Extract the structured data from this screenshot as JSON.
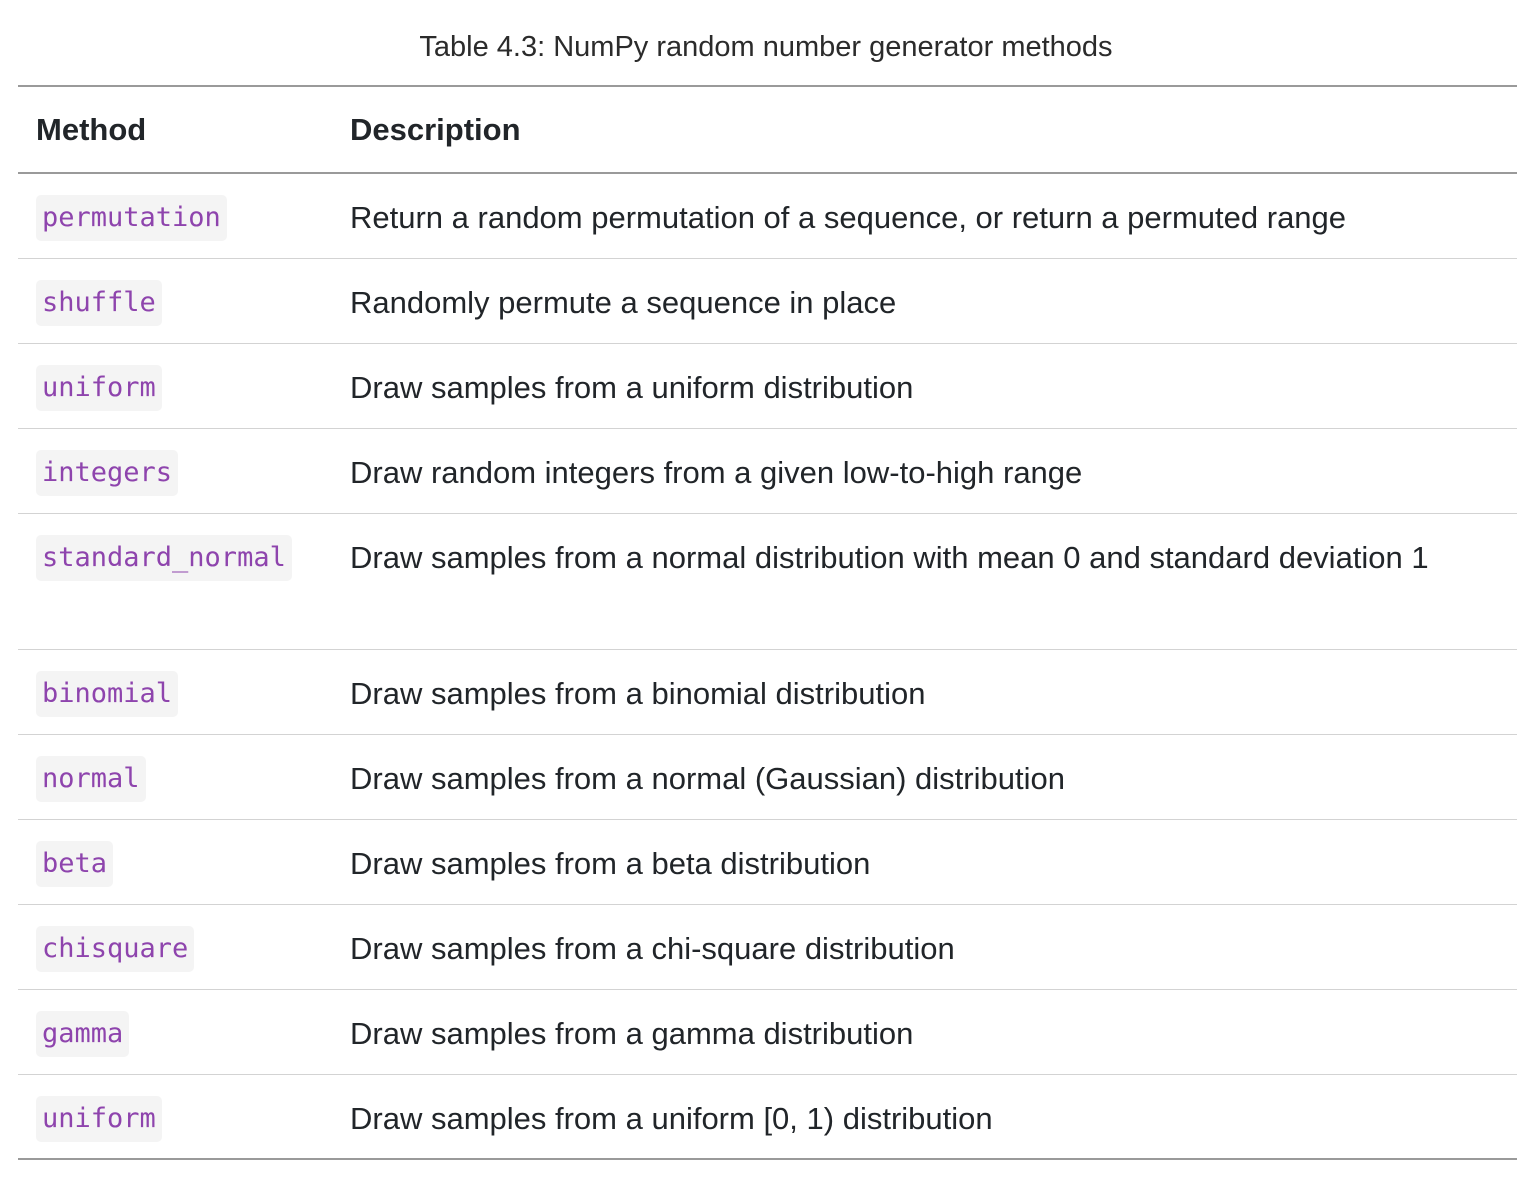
{
  "caption": "Table 4.3: NumPy random number generator methods",
  "table": {
    "headers": [
      "Method",
      "Description"
    ],
    "rows": [
      {
        "method": "permutation",
        "description": "Return a random permutation of a sequence, or return a permuted range"
      },
      {
        "method": "shuffle",
        "description": "Randomly permute a sequence in place"
      },
      {
        "method": "uniform",
        "description": "Draw samples from a uniform distribution"
      },
      {
        "method": "integers",
        "description": "Draw random integers from a given low-to-high range"
      },
      {
        "method": "standard_normal",
        "description": "Draw samples from a normal distribution with mean 0 and standard deviation 1"
      },
      {
        "method": "binomial",
        "description": "Draw samples from a binomial distribution"
      },
      {
        "method": "normal",
        "description": "Draw samples from a normal (Gaussian) distribution"
      },
      {
        "method": "beta",
        "description": "Draw samples from a beta distribution"
      },
      {
        "method": "chisquare",
        "description": "Draw samples from a chi-square distribution"
      },
      {
        "method": "gamma",
        "description": "Draw samples from a gamma distribution"
      },
      {
        "method": "uniform",
        "description": "Draw samples from a uniform [0, 1) distribution"
      }
    ]
  },
  "colors": {
    "code_text": "#8e44ad",
    "code_background": "#f4f4f4",
    "rule_strong": "#9a9a9a",
    "rule_light": "#d3d3d3"
  }
}
